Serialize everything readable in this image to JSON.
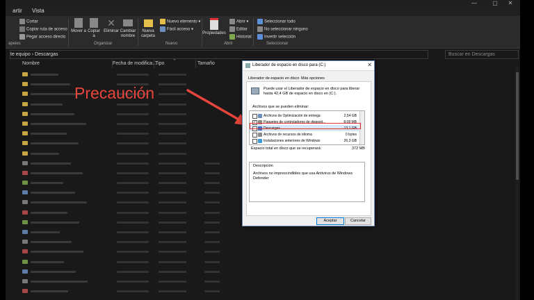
{
  "window": {
    "controls": {
      "min": "—",
      "max": "▢",
      "close": "✕"
    }
  },
  "menu": [
    "artir",
    "Vista"
  ],
  "ribbon": {
    "clipboard": {
      "cut": "Cortar",
      "copy_path": "Copiar ruta de acceso",
      "paste_shortcut": "Pegar acceso directo",
      "group": "apeles"
    },
    "organize": {
      "move": "Mover a",
      "copy": "Copiar a",
      "delete": "Eliminar",
      "rename": "Cambiar nombre",
      "group": "Organizar"
    },
    "new": {
      "new_folder": "Nueva carpeta",
      "new_item": "Nuevo elemento",
      "easy_access": "Fácil acceso",
      "group": "Nuevo"
    },
    "open": {
      "properties": "Propiedades",
      "open": "Abrir",
      "edit": "Editar",
      "history": "Historial",
      "group": "Abrir"
    },
    "select": {
      "select_all": "Seleccionar todo",
      "select_none": "No seleccionar ninguno",
      "invert": "Invertir selección",
      "group": "Seleccionar"
    }
  },
  "address": {
    "path": "te equipo  ›  Descargas",
    "search_placeholder": "Buscar en Descargas"
  },
  "columns": {
    "name": "Nombre",
    "date": "Fecha de modifica...",
    "type": "Tipo",
    "size": "Tamaño"
  },
  "annotation": {
    "text": "Precaución",
    "color": "#e8453c"
  },
  "dialog": {
    "title": "Liberador de espacio en disco para  (C:)",
    "tabs": [
      "Liberador de espacio en disco",
      "Más opciones"
    ],
    "intro": [
      "Puede usar el Liberador de espacio en disco para liberar",
      "hasta 42,4 GB de espacio en disco en  (C:)."
    ],
    "files_label": "Archivos que se pueden eliminar:",
    "items": [
      {
        "name": "Archivos de Optimización de entrega",
        "size": "2,54 GB",
        "checked": false,
        "icon_color": "#6c8ebf"
      },
      {
        "name": "Paquetes de controladores de disposit...",
        "size": "8,08 MB",
        "checked": true,
        "icon_color": "#8a8a8a"
      },
      {
        "name": "Descargas",
        "size": "13,1 GB",
        "checked": false,
        "icon_color": "#3d6fc4"
      },
      {
        "name": "Archivos de recursos de idioma",
        "size": "0 bytes",
        "checked": false,
        "icon_color": "#8a8a8a"
      },
      {
        "name": "Instalaciones anteriores de Windows",
        "size": "26,3 GB",
        "checked": false,
        "icon_color": "#3a9bd8"
      }
    ],
    "total_label": "Espacio total en disco que se recuperará:",
    "total_value": "372 MB",
    "description_label": "Descripción",
    "description_text": [
      "Archivos no imprescindibles que usa Antivirus de Windows",
      "Defender"
    ],
    "ok": "Aceptar",
    "cancel": "Cancelar"
  }
}
